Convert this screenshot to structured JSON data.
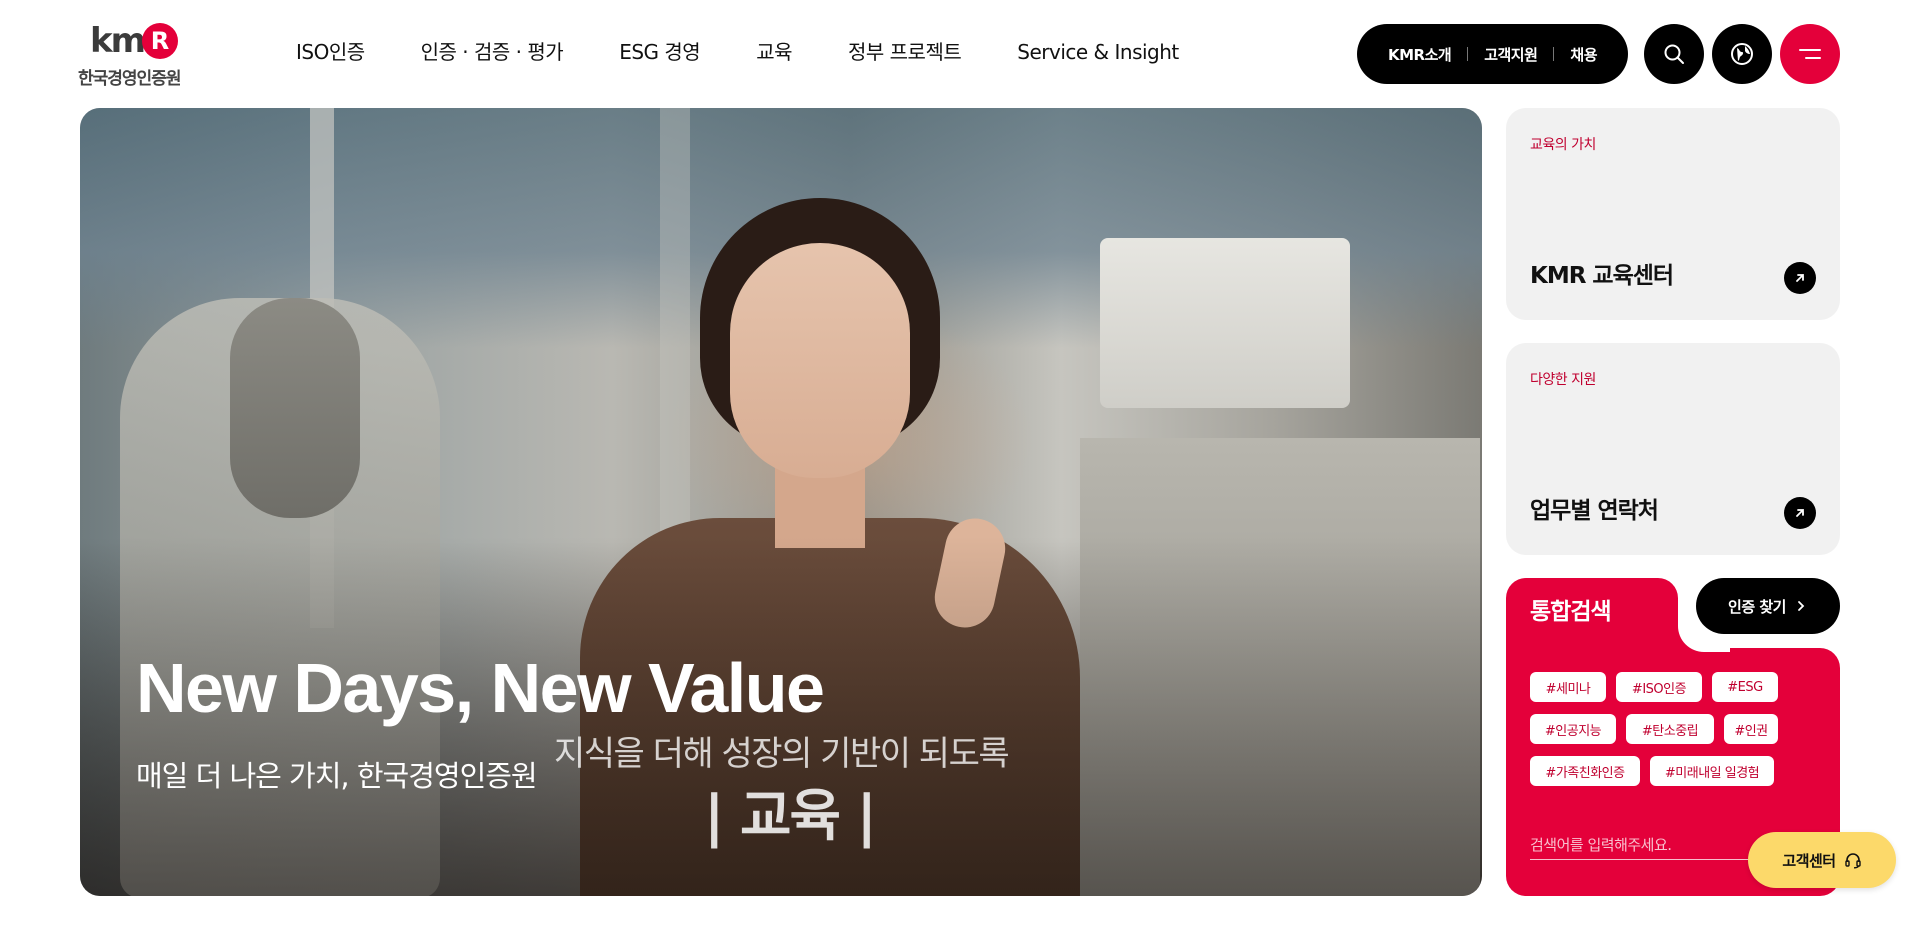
{
  "brand": {
    "logo_mark": "km",
    "logo_r": "R",
    "logo_sub": "한국경영인증원",
    "accent_color": "#e4003a",
    "dark_color": "#000000",
    "cs_color": "#fcd96a"
  },
  "nav": {
    "items": [
      {
        "label": "ISO인증"
      },
      {
        "label": "인증 · 검증 · 평가"
      },
      {
        "label": "ESG 경영"
      },
      {
        "label": "교육"
      },
      {
        "label": "정부 프로젝트"
      },
      {
        "label": "Service & Insight"
      }
    ]
  },
  "utility": {
    "links": [
      {
        "label": "KMR소개"
      },
      {
        "label": "고객지원"
      },
      {
        "label": "채용"
      }
    ],
    "icons": [
      "search-icon",
      "globe-icon",
      "menu-icon"
    ]
  },
  "hero": {
    "title": "New Days, New Value",
    "subtitle": "매일 더 나은 가치, 한국경영인증원",
    "caption": "지식을 더해 성장의 기반이 되도록",
    "tag": "| 교육 |"
  },
  "cards": [
    {
      "kicker": "교육의 가치",
      "title": "KMR 교육센터",
      "icon": "arrow-up-right-icon"
    },
    {
      "kicker": "다양한 지원",
      "title": "업무별 연락처",
      "icon": "arrow-up-right-icon"
    }
  ],
  "search": {
    "title": "통합검색",
    "find_label": "인증 찾기",
    "find_icon": "chevron-right-icon",
    "tags": [
      "#세미나",
      "#ISO인증",
      "#ESG",
      "#인공지능",
      "#탄소중립",
      "#인권",
      "#가족친화인증",
      "#미래내일 일경험"
    ],
    "placeholder": "검색어를 입력해주세요."
  },
  "cs": {
    "label": "고객센터",
    "icon": "headset-icon"
  }
}
